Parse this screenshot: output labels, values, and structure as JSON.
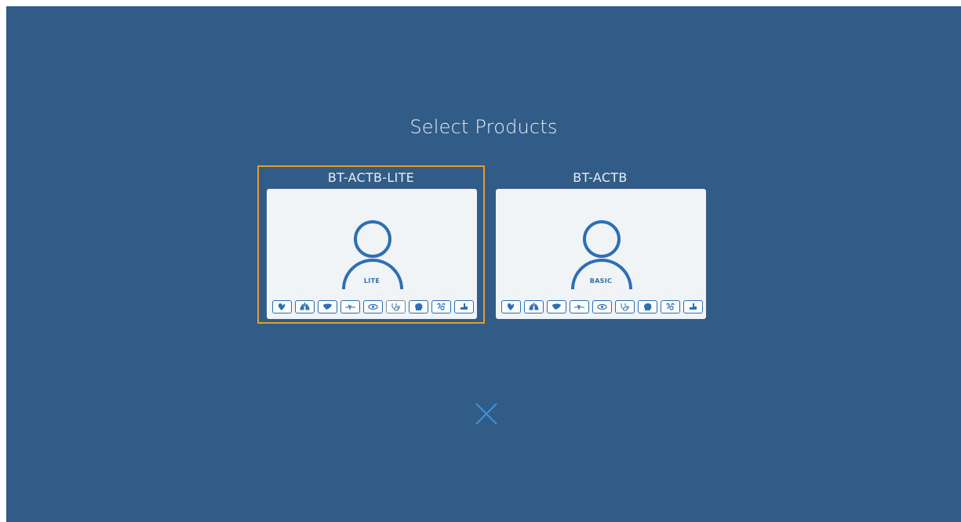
{
  "title": "Select Products",
  "products": [
    {
      "name": "BT-ACTB-LITE",
      "tier": "LITE",
      "selected": true,
      "icons": [
        "heart-icon",
        "lungs-icon",
        "liver-icon",
        "ecg-icon",
        "eye-icon",
        "stethoscope-icon",
        "head-icon",
        "reproductive-icon",
        "kidney-icon"
      ]
    },
    {
      "name": "BT-ACTB",
      "tier": "BASIC",
      "selected": false,
      "icons": [
        "heart-icon",
        "lungs-icon",
        "liver-icon",
        "ecg-icon",
        "eye-icon",
        "stethoscope-icon",
        "head-icon",
        "reproductive-icon",
        "kidney-icon"
      ]
    }
  ],
  "colors": {
    "background": "#315c88",
    "card": "#f1f4f7",
    "accent_blue": "#2d6fb5",
    "selection": "#e99a2c",
    "close": "#3f8fd8"
  },
  "close_icon": "close-icon"
}
